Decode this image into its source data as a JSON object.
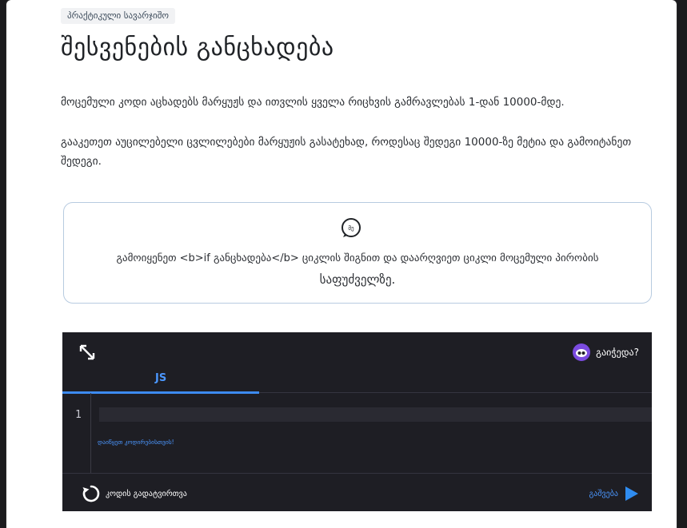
{
  "lesson": {
    "badge": "პრაქტიკული სავარჯიშო",
    "title": "შესვენების განცხადება",
    "paragraph1": "მოცემული კოდი აცხადებს მარყუჟს და ითვლის ყველა რიცხვის გამრავლებას 1-დან 10000-მდე.",
    "paragraph2": "გააკეთეთ აუცილებელი ცვლილებები მარყუჟის გასატეხად, როდესაც შედეგი 10000-ზე მეტია და გამოიტანეთ შედეგი."
  },
  "hint": {
    "icon_label": "მე",
    "line1": "გამოიყენეთ <b>if განცხადება</b> ციკლის შიგნით და დაარღვიეთ ციკლი მოცემული პირობის",
    "line2": "საფუძველზე."
  },
  "editor": {
    "help_label": "გაიჭედა?",
    "tab_label": "JS",
    "line_number": "1",
    "code_placeholder": "დაიწყეთ კოდირებისთვის!",
    "reset_label": "კოდის გადატვირთვა",
    "run_label": "გაშვება"
  },
  "colors": {
    "accent": "#4b97ff",
    "editor_bg": "#1e1e24",
    "hint_border": "#b7cbe0"
  }
}
